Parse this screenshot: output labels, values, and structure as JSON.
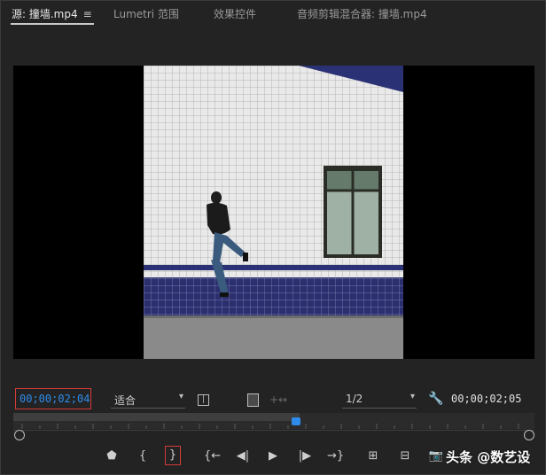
{
  "tabs": [
    {
      "label": "源: 撞墙.mp4"
    },
    {
      "label": "Lumetri 范围"
    },
    {
      "label": "效果控件"
    },
    {
      "label": "音频剪辑混合器: 撞墙.mp4"
    }
  ],
  "controls": {
    "current_timecode": "00;00;02;04",
    "fit_value": "适合",
    "resolution_value": "1/2",
    "duration_timecode": "00;00;02;05"
  },
  "icons": {
    "menu": "hamburger-icon",
    "settings": "wrench-icon"
  },
  "watermark": "头条 @数艺设",
  "colors": {
    "background": "#232323",
    "accent": "#2d8ceb",
    "highlight": "#d53a3a"
  }
}
